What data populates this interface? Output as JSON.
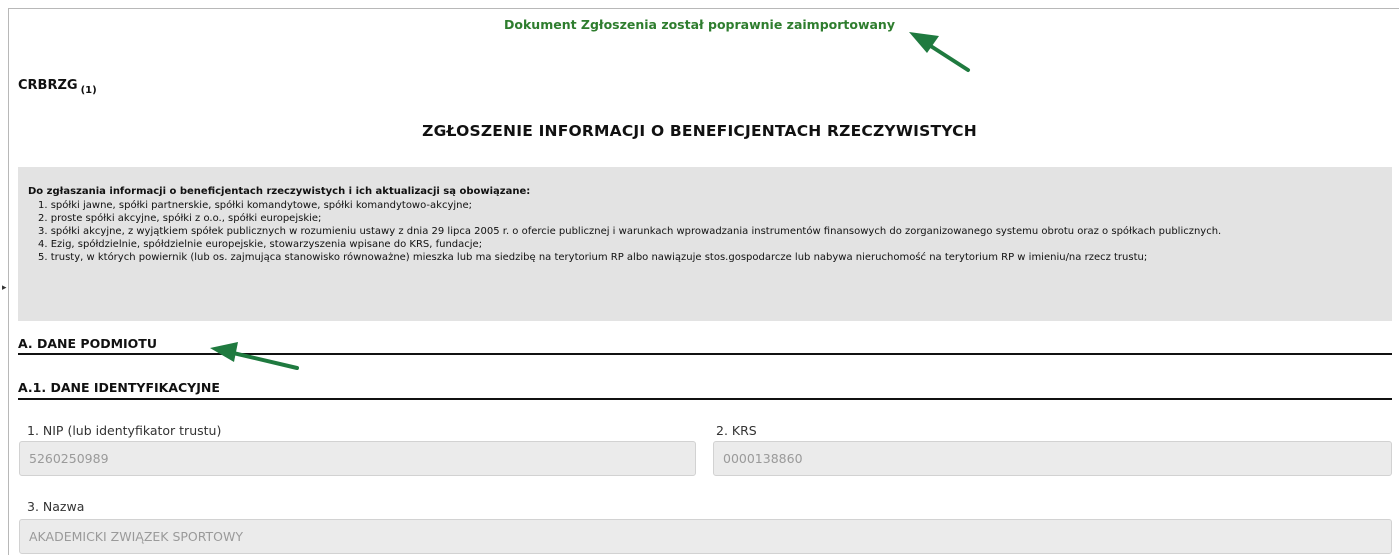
{
  "banner": {
    "success_message": "Dokument Zgłoszenia został poprawnie zaimportowany"
  },
  "form": {
    "code": "CRBRZG",
    "code_sub": "(1)",
    "title": "ZGŁOSZENIE INFORMACJI O BENEFICJENTACH RZECZYWISTYCH"
  },
  "info": {
    "heading": "Do zgłaszania informacji o beneficjentach rzeczywistych i ich aktualizacji są obowiązane:",
    "items": [
      "1. spółki jawne, spółki partnerskie, spółki komandytowe, spółki komandytowo-akcyjne;",
      "2. proste spółki akcyjne, spółki z o.o., spółki europejskie;",
      "3. spółki akcyjne, z wyjątkiem spółek publicznych w rozumieniu ustawy z dnia 29 lipca 2005 r. o ofercie publicznej i warunkach wprowadzania instrumentów finansowych do zorganizowanego systemu obrotu oraz o spółkach publicznych.",
      "4. Ezig, spółdzielnie, spółdzielnie europejskie, stowarzyszenia wpisane do KRS, fundacje;",
      "5. trusty, w których powiernik (lub os. zajmująca stanowisko równoważne) mieszka lub ma siedzibę na terytorium RP albo nawiązuje stos.gospodarcze lub nabywa nieruchomość na terytorium RP w imieniu/na rzecz trustu;"
    ]
  },
  "sections": {
    "a_title": "A. DANE PODMIOTU",
    "a1_title": "A.1. DANE IDENTYFIKACYJNE"
  },
  "fields": {
    "nip": {
      "label": "1. NIP (lub identyfikator trustu)",
      "value": "5260250989"
    },
    "krs": {
      "label": "2. KRS",
      "value": "0000138860"
    },
    "nazwa": {
      "label": "3. Nazwa",
      "value": "AKADEMICKI ZWIĄZEK SPORTOWY"
    }
  },
  "colors": {
    "success": "#2e7d2e",
    "arrow": "#1f7a3f",
    "info_bg": "#e3e3e3",
    "field_bg": "#ebebeb"
  }
}
